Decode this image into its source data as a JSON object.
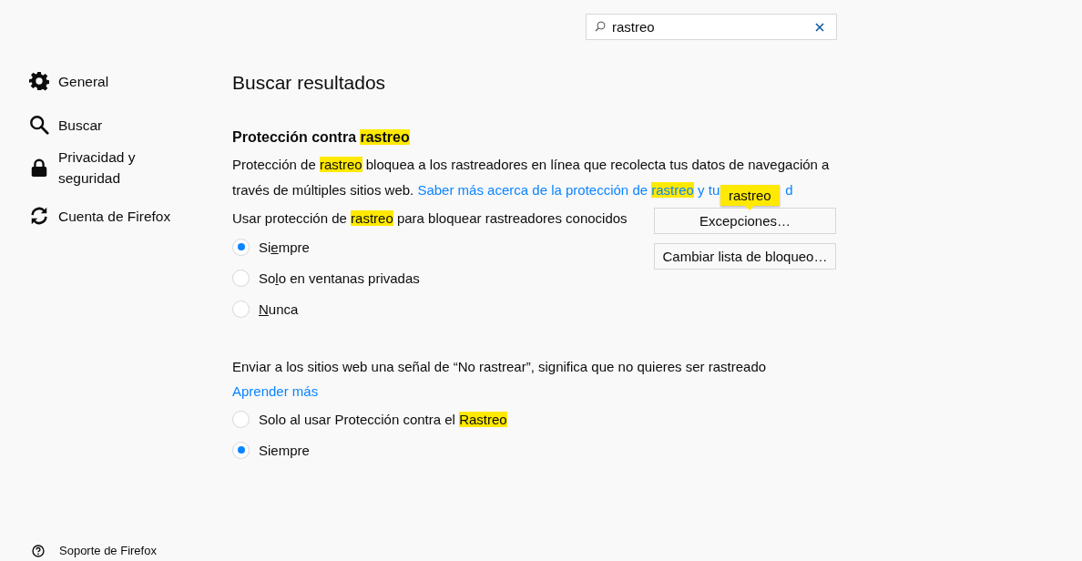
{
  "search": {
    "value": "rastreo"
  },
  "sidebar": {
    "items": [
      {
        "label": "General",
        "selected": false
      },
      {
        "label": "Buscar",
        "selected": false
      },
      {
        "label": "Privacidad y seguridad",
        "selected": false
      },
      {
        "label": "Cuenta de Firefox",
        "selected": false
      }
    ],
    "footer": {
      "label": "Soporte de Firefox"
    }
  },
  "heading": "Buscar resultados",
  "section": {
    "title": [
      {
        "text": "Protección contra ",
        "highlighted": false
      },
      {
        "text": "rastreo",
        "highlighted": true
      }
    ],
    "description": [
      {
        "text": "Protección de ",
        "highlighted": false
      },
      {
        "text": "rastreo",
        "highlighted": true
      },
      {
        "text": " bloquea a los rastreadores en línea que recolecta tus datos de navegación a través de múltiples sitios web. ",
        "highlighted": false
      }
    ],
    "link": [
      {
        "text": "Saber más acerca de la protección de ",
        "highlighted": false
      },
      {
        "text": "rastreo",
        "highlighted": true
      },
      {
        "text": " y tu",
        "highlighted": false
      },
      {
        "text": "d",
        "highlighted": false,
        "covered_before": true
      }
    ],
    "tooltip": "rastreo",
    "option_label": [
      {
        "text": "Usar protección de ",
        "highlighted": false
      },
      {
        "text": "rastreo",
        "highlighted": true
      },
      {
        "text": " para bloquear rastreadores conocidos",
        "highlighted": false
      }
    ],
    "options": [
      {
        "label": [
          {
            "text": "Si",
            "underlined": false
          },
          {
            "text": "e",
            "underlined": true
          },
          {
            "text": "mpre",
            "underlined": false
          }
        ],
        "selected": true
      },
      {
        "label": [
          {
            "text": "So",
            "underlined": false
          },
          {
            "text": "l",
            "underlined": true
          },
          {
            "text": "o en ventanas privadas",
            "underlined": false
          }
        ],
        "selected": false
      },
      {
        "label": [
          {
            "text": "N",
            "underlined": true
          },
          {
            "text": "unca",
            "underlined": false
          }
        ],
        "selected": false
      }
    ],
    "buttons": [
      "Excepciones…",
      "Cambiar lista de bloqueo…"
    ]
  },
  "dnt": {
    "description": "Enviar a los sitios web una señal de “No rastrear”, significa que no quieres ser rastreado",
    "link": "Aprender más",
    "options": [
      {
        "label": [
          {
            "text": "Solo al usar Protección contra el ",
            "highlighted": false
          },
          {
            "text": "Rastreo",
            "highlighted": true
          }
        ],
        "selected": false
      },
      {
        "label": [
          {
            "text": "Siempre",
            "highlighted": false
          }
        ],
        "selected": true
      }
    ]
  }
}
